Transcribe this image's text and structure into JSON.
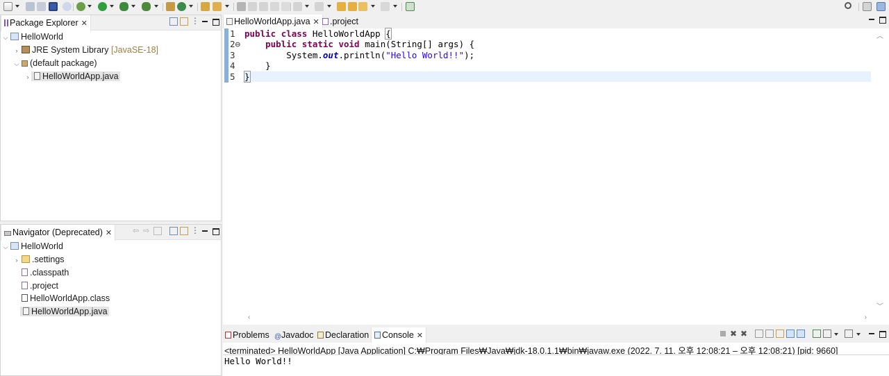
{
  "package_explorer": {
    "title": "Package Explorer",
    "tree": {
      "project": "HelloWorld",
      "jre_library": "JRE System Library",
      "jre_version": "[JavaSE-18]",
      "package": "(default package)",
      "file": "HelloWorldApp.java"
    }
  },
  "navigator": {
    "title": "Navigator (Deprecated)",
    "tree": {
      "project": "HelloWorld",
      "settings": ".settings",
      "classpath": ".classpath",
      "project_file": ".project",
      "class_file": "HelloWorldApp.class",
      "java_file": "HelloWorldApp.java"
    }
  },
  "editor": {
    "tabs": [
      {
        "label": "HelloWorldApp.java"
      },
      {
        "label": ".project"
      }
    ],
    "line_numbers": [
      "1",
      "2⊖",
      "3",
      "4",
      "5"
    ],
    "code": {
      "l1_kw1": "public",
      "l1_kw2": "class",
      "l1_name": "HelloWorldApp",
      "l1_brace": "{",
      "l2_kw1": "public",
      "l2_kw2": "static",
      "l2_kw3": "void",
      "l2_rest": "main(String[] args) {",
      "l3_pre": "System.",
      "l3_field": "out",
      "l3_mid": ".println(",
      "l3_str": "\"Hello World!!\"",
      "l3_end": ");",
      "l4": "}",
      "l5": "}"
    }
  },
  "bottom": {
    "tabs": [
      {
        "label": "Problems"
      },
      {
        "label": "Javadoc"
      },
      {
        "label": "Declaration"
      },
      {
        "label": "Console"
      }
    ],
    "console_status": "<terminated> HelloWorldApp [Java Application] C:₩Program Files₩Java₩jdk-18.0.1.1₩bin₩javaw.exe  (2022. 7. 11. 오후 12:08:21 – 오후 12:08:21) [pid: 9660]",
    "console_output": "Hello World!!"
  },
  "colors": {
    "keyword": "#7f0055",
    "string": "#2a00ff",
    "field": "#0000c0",
    "current_line": "#e8f2fe"
  }
}
